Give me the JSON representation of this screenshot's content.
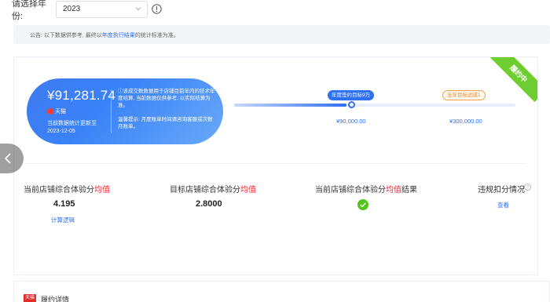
{
  "filter": {
    "year_label": "请选择年份:",
    "year_value": "2023"
  },
  "notice": {
    "prefix": "公告: 以下数据供参考, 最终以",
    "highlight": "年度执行结果",
    "suffix": "的统计标准为准。"
  },
  "ribbon": "履约中",
  "card": {
    "amount": "¥91,281.74",
    "brand": "天猫",
    "updated_label": "当前数据统计更新至",
    "updated_date": "2023-12-05",
    "desc": "ⓘ该成交数数据用于店铺目前年内的技术年度结算, 当前数据仅供参考, 以实际结算为准。",
    "desc2": "温馨提示: 月度账单时间请咨询客服或次数月账单。"
  },
  "progress": {
    "fill_fraction": 0.4,
    "tag_current": "年度签约目标9万",
    "tag_target": "全年目标达成1",
    "value_current": "¥90,000.00",
    "value_target": "¥300,000.00"
  },
  "stats": {
    "col1_label": "当前店铺综合体验分",
    "col1_red": "均值",
    "col1_value": "4.195",
    "col1_link": "计算逻辑",
    "col2_label": "目标店铺综合体验分",
    "col2_red": "均值",
    "col2_value": "2.8000",
    "col3_label": "当前店铺综合体验分",
    "col3_red": "均值",
    "col3_suffix": "结果",
    "col4_label": "违规扣分情况",
    "col4_link": "查看"
  },
  "bottom": {
    "badge": "天猫",
    "title": "履约详情"
  },
  "colors": {
    "accent": "#2f6ff2",
    "success": "#52c41a",
    "ribbon": "#6ece2f",
    "warn": "#f5222d"
  }
}
